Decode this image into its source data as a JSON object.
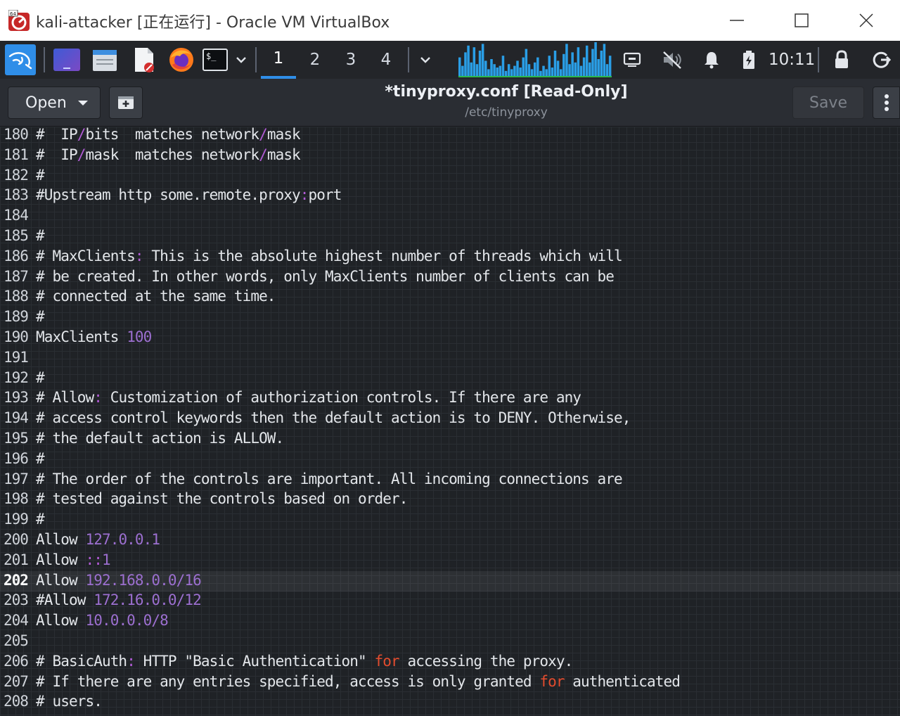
{
  "window": {
    "title": "kali-attacker [正在运行] - Oracle VM VirtualBox",
    "controls": [
      "minimize",
      "maximize",
      "close"
    ]
  },
  "panel": {
    "launchers": [
      "kali-menu-icon",
      "workspace-preview-icon",
      "file-manager-icon",
      "text-editor-icon",
      "firefox-icon",
      "terminal-icon"
    ],
    "workspaces": [
      "1",
      "2",
      "3",
      "4"
    ],
    "active_workspace": "1",
    "cpu_graph": [
      0.55,
      0.3,
      0.7,
      0.9,
      0.4,
      0.85,
      0.35,
      0.75,
      0.95,
      0.45,
      0.2,
      0.5,
      0.35,
      0.25,
      0.3,
      0.6,
      0.15,
      0.35,
      0.2,
      0.3,
      0.45,
      0.25,
      0.55,
      0.8,
      0.35,
      0.2,
      0.4,
      0.55,
      0.15,
      0.3,
      0.2,
      0.6,
      0.25,
      0.75,
      0.45,
      0.2,
      0.65,
      0.95,
      0.35,
      0.7,
      0.4,
      0.85,
      0.3,
      0.55,
      0.9,
      0.4,
      0.8,
      1.0,
      0.5,
      0.75,
      0.95,
      0.35,
      0.6
    ],
    "tray_icons": [
      "network-icon",
      "volume-muted-icon",
      "notifications-icon",
      "battery-icon"
    ],
    "clock": "10:11",
    "actions": [
      "lock-icon",
      "logout-icon"
    ]
  },
  "editor": {
    "open_label": "Open",
    "title": "*tinyproxy.conf [Read-Only]",
    "subtitle": "/etc/tinyproxy",
    "save_label": "Save",
    "current_line": "202",
    "lines": [
      {
        "num": "180",
        "segments": [
          {
            "t": "#  IP",
            "c": "c-comment"
          },
          {
            "t": "/",
            "c": "c-punct"
          },
          {
            "t": "bits  matches network",
            "c": "c-comment"
          },
          {
            "t": "/",
            "c": "c-punct"
          },
          {
            "t": "mask",
            "c": "c-comment"
          }
        ]
      },
      {
        "num": "181",
        "segments": [
          {
            "t": "#  IP",
            "c": "c-comment"
          },
          {
            "t": "/",
            "c": "c-punct"
          },
          {
            "t": "mask  matches network",
            "c": "c-comment"
          },
          {
            "t": "/",
            "c": "c-punct"
          },
          {
            "t": "mask",
            "c": "c-comment"
          }
        ]
      },
      {
        "num": "182",
        "segments": [
          {
            "t": "#",
            "c": "c-comment"
          }
        ]
      },
      {
        "num": "183",
        "segments": [
          {
            "t": "#Upstream http some.remote.proxy",
            "c": "c-comment"
          },
          {
            "t": ":",
            "c": "c-punct"
          },
          {
            "t": "port",
            "c": "c-comment"
          }
        ]
      },
      {
        "num": "184",
        "segments": []
      },
      {
        "num": "185",
        "segments": [
          {
            "t": "#",
            "c": "c-comment"
          }
        ]
      },
      {
        "num": "186",
        "segments": [
          {
            "t": "# MaxClients",
            "c": "c-comment"
          },
          {
            "t": ":",
            "c": "c-punct"
          },
          {
            "t": " This is the absolute highest number of threads which will",
            "c": "c-comment"
          }
        ]
      },
      {
        "num": "187",
        "segments": [
          {
            "t": "# be created. In other words, only MaxClients number of clients can be",
            "c": "c-comment"
          }
        ]
      },
      {
        "num": "188",
        "segments": [
          {
            "t": "# connected at the same time.",
            "c": "c-comment"
          }
        ]
      },
      {
        "num": "189",
        "segments": [
          {
            "t": "#",
            "c": "c-comment"
          }
        ]
      },
      {
        "num": "190",
        "segments": [
          {
            "t": "MaxClients ",
            "c": "c-comment"
          },
          {
            "t": "100",
            "c": "c-num"
          }
        ]
      },
      {
        "num": "191",
        "segments": []
      },
      {
        "num": "192",
        "segments": [
          {
            "t": "#",
            "c": "c-comment"
          }
        ]
      },
      {
        "num": "193",
        "segments": [
          {
            "t": "# Allow",
            "c": "c-comment"
          },
          {
            "t": ":",
            "c": "c-punct"
          },
          {
            "t": " Customization of authorization controls. If there are any",
            "c": "c-comment"
          }
        ]
      },
      {
        "num": "194",
        "segments": [
          {
            "t": "# access control keywords then the default action is to DENY. Otherwise,",
            "c": "c-comment"
          }
        ]
      },
      {
        "num": "195",
        "segments": [
          {
            "t": "# the default action is ALLOW.",
            "c": "c-comment"
          }
        ]
      },
      {
        "num": "196",
        "segments": [
          {
            "t": "#",
            "c": "c-comment"
          }
        ]
      },
      {
        "num": "197",
        "segments": [
          {
            "t": "# The order of the controls are important. All incoming connections are",
            "c": "c-comment"
          }
        ]
      },
      {
        "num": "198",
        "segments": [
          {
            "t": "# tested against the controls based on order.",
            "c": "c-comment"
          }
        ]
      },
      {
        "num": "199",
        "segments": [
          {
            "t": "#",
            "c": "c-comment"
          }
        ]
      },
      {
        "num": "200",
        "segments": [
          {
            "t": "Allow ",
            "c": "c-comment"
          },
          {
            "t": "127.0.0.1",
            "c": "c-num"
          }
        ]
      },
      {
        "num": "201",
        "segments": [
          {
            "t": "Allow ",
            "c": "c-comment"
          },
          {
            "t": "::",
            "c": "c-punct"
          },
          {
            "t": "1",
            "c": "c-num"
          }
        ]
      },
      {
        "num": "202",
        "segments": [
          {
            "t": "Allow ",
            "c": "c-comment"
          },
          {
            "t": "192.168.0.0/16",
            "c": "c-num"
          }
        ]
      },
      {
        "num": "203",
        "segments": [
          {
            "t": "#Allow ",
            "c": "c-comment"
          },
          {
            "t": "172.16.0.0/12",
            "c": "c-num"
          }
        ]
      },
      {
        "num": "204",
        "segments": [
          {
            "t": "Allow ",
            "c": "c-comment"
          },
          {
            "t": "10.0.0.0/8",
            "c": "c-num"
          }
        ]
      },
      {
        "num": "205",
        "segments": []
      },
      {
        "num": "206",
        "segments": [
          {
            "t": "# BasicAuth",
            "c": "c-comment"
          },
          {
            "t": ":",
            "c": "c-punct"
          },
          {
            "t": " HTTP \"Basic Authentication\" ",
            "c": "c-comment"
          },
          {
            "t": "for",
            "c": "c-kw"
          },
          {
            "t": " accessing the proxy.",
            "c": "c-comment"
          }
        ]
      },
      {
        "num": "207",
        "segments": [
          {
            "t": "# If there are any entries specified, access is only granted ",
            "c": "c-comment"
          },
          {
            "t": "for",
            "c": "c-kw"
          },
          {
            "t": " authenticated",
            "c": "c-comment"
          }
        ]
      },
      {
        "num": "208",
        "segments": [
          {
            "t": "# users.",
            "c": "c-comment"
          }
        ]
      }
    ]
  },
  "colors": {
    "accent": "#2f8ee8",
    "cpu_graph": "#2a9ee6",
    "punctuation": "#b25bd6",
    "number": "#9c6fd0",
    "keyword": "#e34c2e"
  }
}
